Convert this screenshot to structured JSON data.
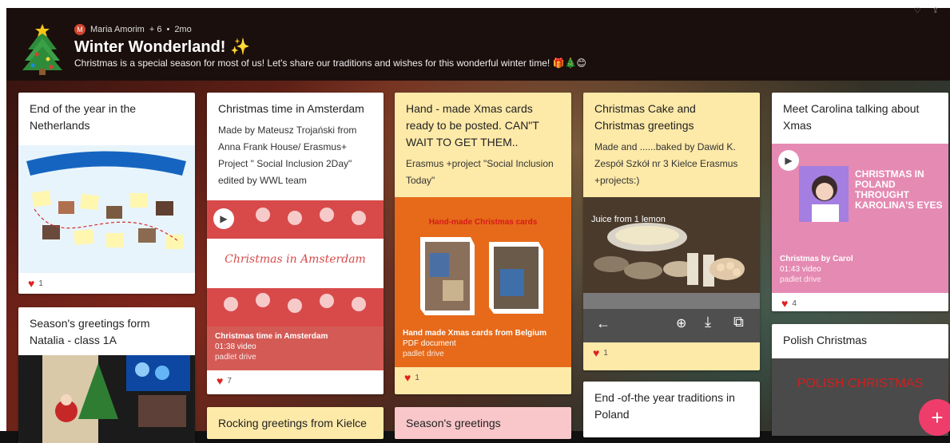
{
  "header": {
    "author": "Maria Amorim",
    "avatar_letter": "M",
    "collaborators": "+ 6",
    "separator": "•",
    "age": "2mo",
    "title": "Winter Wonderland! ✨",
    "subtitle": "Christmas is a special season for most of us! Let's share our traditions and wishes for this wonderful winter time! 🎁🎄😊"
  },
  "cards": {
    "c1": {
      "title": "End of the year in the Netherlands",
      "likes": "1"
    },
    "c2": {
      "title": "Season's greetings form Natalia - class 1A"
    },
    "c3": {
      "title": "Christmas time in Amsterdam",
      "body": "Made by Mateusz Trojański from Anna Frank House/ Erasmus+ Project \" Social Inclusion 2Day\" edited by WWL team",
      "att_title": "Christmas time in Amsterdam",
      "att_meta": "01:38 video",
      "att_source": "padlet drive",
      "video_text": "Christmas in Amsterdam",
      "likes": "7"
    },
    "c4": {
      "title": "Rocking greetings from Kielce"
    },
    "c5": {
      "title": "Hand - made Xmas cards ready to be posted. CAN\"T WAIT TO GET THEM..",
      "body": "Erasmus +project \"Social Inclusion Today\"",
      "image_text": "Hand-made Christmas cards",
      "att_title": "Hand made Xmas cards from Belgium",
      "att_meta": "PDF document",
      "att_source": "padlet drive",
      "likes": "1"
    },
    "c6": {
      "title": "Season's greetings"
    },
    "c7": {
      "title": "Christmas Cake and Christmas greetings",
      "body": "Made and ......baked by Dawid K. Zespół Szkół nr 3 Kielce Erasmus +projects:)",
      "image_text": "Juice from 1 lemon",
      "likes": "1"
    },
    "c8": {
      "title": "End -of-the year traditions in Poland"
    },
    "c9": {
      "title": "Meet Carolina talking about Xmas",
      "video_text": "CHRISTMAS IN POLAND THROUGHT KAROLINA'S EYES",
      "att_title": "Christmas by Carol",
      "att_meta": "01:43 video",
      "att_source": "padlet drive",
      "likes": "4"
    },
    "c10": {
      "title": "Polish Christmas",
      "image_text": "POLISH CHRISTMAS"
    }
  },
  "fab": {
    "label": "+"
  },
  "colors": {
    "accent": "#ee3d6a",
    "heart": "#e02020",
    "yellow_card": "#fde9a8",
    "pink_card": "#f9c6c9"
  }
}
